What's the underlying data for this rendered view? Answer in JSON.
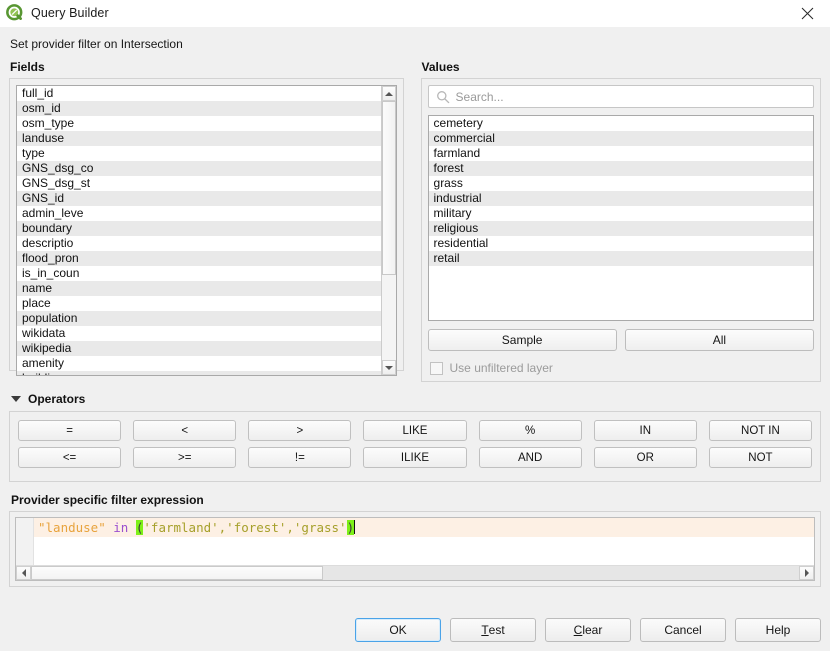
{
  "window": {
    "title": "Query Builder",
    "logo_icon": "qgis-logo-icon",
    "close_icon": "close-icon"
  },
  "subtitle": "Set provider filter on Intersection",
  "fields": {
    "label": "Fields",
    "items": [
      "full_id",
      "osm_id",
      "osm_type",
      "landuse",
      "type",
      "GNS_dsg_co",
      "GNS_dsg_st",
      "GNS_id",
      "admin_leve",
      "boundary",
      "descriptio",
      "flood_pron",
      "is_in_coun",
      "name",
      "place",
      "population",
      "wikidata",
      "wikipedia",
      "amenity",
      "building"
    ],
    "scroll": {
      "thumb_top_pct": 0,
      "thumb_height_pct": 67
    }
  },
  "values": {
    "label": "Values",
    "search": {
      "placeholder": "Search...",
      "value": "",
      "icon": "search-icon"
    },
    "items": [
      "cemetery",
      "commercial",
      "farmland",
      "forest",
      "grass",
      "industrial",
      "military",
      "religious",
      "residential",
      "retail"
    ],
    "sample_label": "Sample",
    "all_label": "All",
    "unfiltered": {
      "label": "Use unfiltered layer",
      "checked": false,
      "enabled": false
    }
  },
  "operators": {
    "label": "Operators",
    "collapse_icon": "triangle-down-icon",
    "expanded": true,
    "buttons": [
      "=",
      "<",
      ">",
      "LIKE",
      "%",
      "IN",
      "NOT IN",
      "<=",
      ">=",
      "!=",
      "ILIKE",
      "AND",
      "OR",
      "NOT"
    ]
  },
  "expression": {
    "label": "Provider specific filter expression",
    "text": "\"landuse\" in ('farmland','forest','grass')",
    "tokens": [
      {
        "t": "\"landuse\"",
        "k": "field"
      },
      {
        "t": " ",
        "k": "plain"
      },
      {
        "t": "in",
        "k": "kw"
      },
      {
        "t": " ",
        "k": "plain"
      },
      {
        "t": "(",
        "k": "brace"
      },
      {
        "t": "'farmland','forest','grass'",
        "k": "str"
      },
      {
        "t": ")",
        "k": "brace"
      }
    ],
    "hscroll": {
      "thumb_left_pct": 0,
      "thumb_width_pct": 38
    }
  },
  "footer": {
    "buttons": [
      {
        "label": "OK",
        "mnemonic": "",
        "default": true
      },
      {
        "label": "Test",
        "mnemonic": "T",
        "default": false
      },
      {
        "label": "Clear",
        "mnemonic": "C",
        "default": false
      },
      {
        "label": "Cancel",
        "mnemonic": "",
        "default": false
      },
      {
        "label": "Help",
        "mnemonic": "",
        "default": false
      }
    ]
  },
  "colors": {
    "window_bg": "#f0f0f0",
    "list_bg": "#ffffff",
    "list_alt": "#e9e9e9",
    "current_line": "#fdf0e4",
    "token_field": "#e8a33d",
    "token_keyword": "#9b4fcf",
    "token_string": "#a6a02a",
    "brace_match": "#7ef018",
    "default_button_border": "#4aa3e8",
    "disabled_text": "#9b9b9b"
  }
}
